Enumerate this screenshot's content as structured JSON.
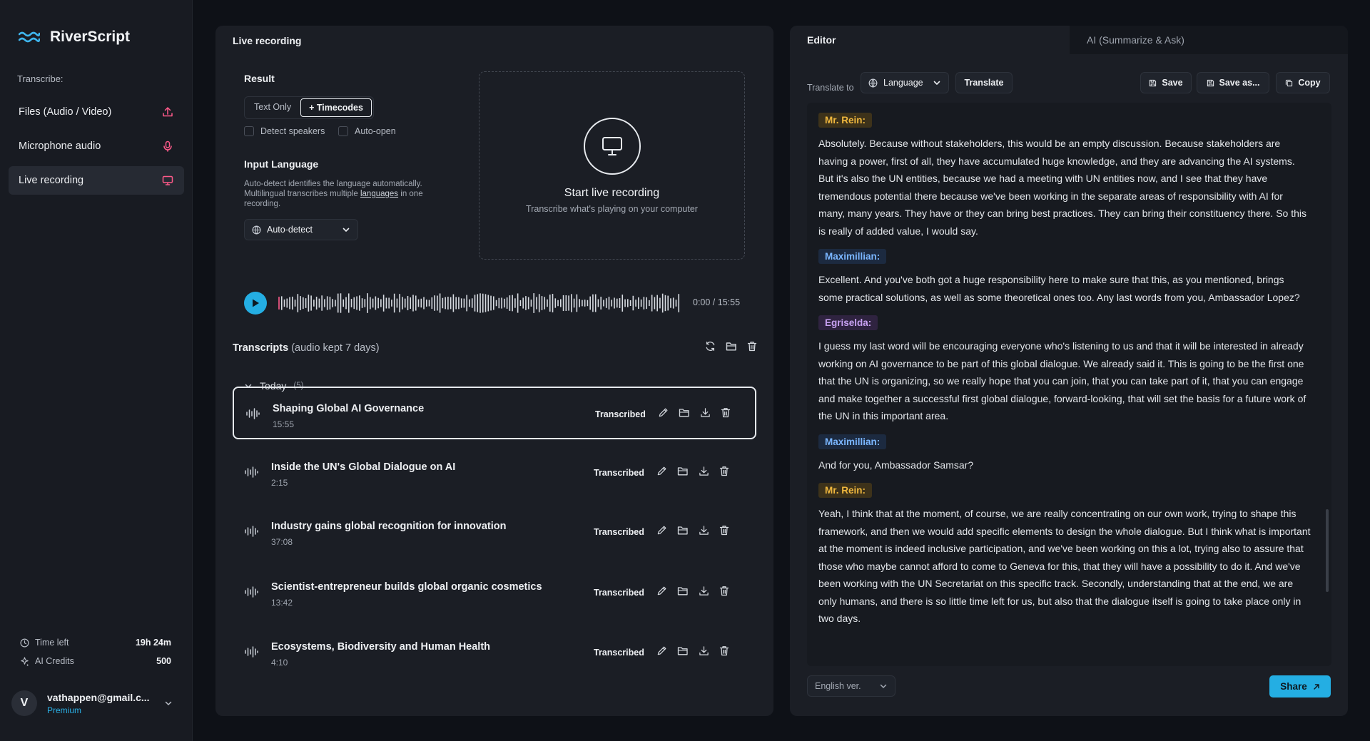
{
  "app": {
    "name": "RiverScript"
  },
  "sidebar": {
    "section_label": "Transcribe:",
    "items": [
      {
        "label": "Files (Audio / Video)",
        "icon": "upload-icon",
        "icon_color": "#ff5a8a"
      },
      {
        "label": "Microphone audio",
        "icon": "microphone-icon",
        "icon_color": "#ff5a8a"
      },
      {
        "label": "Live recording",
        "icon": "monitor-icon",
        "icon_color": "#ff5a8a",
        "active": true
      }
    ],
    "time_left": {
      "label": "Time left",
      "value": "19h 24m"
    },
    "ai_credits": {
      "label": "AI Credits",
      "value": "500"
    },
    "user": {
      "initial": "V",
      "email": "vathappen@gmail.c...",
      "plan": "Premium"
    }
  },
  "live_panel": {
    "title": "Live recording",
    "result_label": "Result",
    "result_options": [
      "Text Only",
      "+ Timecodes"
    ],
    "result_selected": "+ Timecodes",
    "detect_speakers": "Detect speakers",
    "auto_open": "Auto-open",
    "input_language_label": "Input Language",
    "input_language_desc_1": "Auto-detect identifies the language automatically. Multilingual transcribes multiple ",
    "input_language_link": "languages",
    "input_language_desc_2": " in one recording.",
    "language_select": "Auto-detect",
    "drop_title": "Start live recording",
    "drop_sub": "Transcribe what's playing on your computer",
    "player_time": "0:00 / 15:55",
    "progress": 0
  },
  "transcripts": {
    "title": "Transcripts",
    "note": "(audio kept 7 days)",
    "group": "Today",
    "group_count": "(5)",
    "items": [
      {
        "title": "Shaping Global AI Governance",
        "duration": "15:55",
        "status": "Transcribed",
        "selected": true
      },
      {
        "title": "Inside the UN's Global Dialogue on AI",
        "duration": "2:15",
        "status": "Transcribed"
      },
      {
        "title": "Industry gains global recognition for innovation",
        "duration": "37:08",
        "status": "Transcribed"
      },
      {
        "title": "Scientist-entrepreneur builds global organic cosmetics",
        "duration": "13:42",
        "status": "Transcribed"
      },
      {
        "title": "Ecosystems, Biodiversity and Human Health",
        "duration": "4:10",
        "status": "Transcribed"
      }
    ]
  },
  "editor": {
    "tabs": [
      "Editor",
      "AI (Summarize & Ask)"
    ],
    "translate_label": "Translate to",
    "language_select": "Language",
    "translate_button": "Translate",
    "save_button": "Save",
    "save_as_button": "Save as...",
    "copy_button": "Copy",
    "version_select": "English ver.",
    "share_button": "Share",
    "blocks": [
      {
        "speaker": "Mr. Rein:",
        "kind": "rein",
        "text": "Absolutely. Because without stakeholders, this would be an empty discussion. Because stakeholders are having a power, first of all, they have accumulated huge knowledge, and they are advancing the AI systems. But it's also the UN entities, because we had a meeting with UN entities now, and I see that they have tremendous potential there because we've been working in the separate areas of responsibility with AI for many, many years. They have or they can bring best practices. They can bring their constituency there. So this is really of added value, I would say."
      },
      {
        "speaker": "Maximillian:",
        "kind": "max",
        "text": "Excellent. And you've both got a huge responsibility here to make sure that this, as you mentioned, brings some practical solutions, as well as some theoretical ones too. Any last words from you, Ambassador Lopez?"
      },
      {
        "speaker": "Egriselda:",
        "kind": "egr",
        "text": "I guess my last word will be encouraging everyone who's listening to us and that it will be interested in already working on AI governance to be part of this global dialogue. We already said it. This is going to be the first one that the UN is organizing, so we really hope that you can join, that you can take part of it, that you can engage and make together a successful first global dialogue, forward-looking, that will set the basis for a future work of the UN in this important area."
      },
      {
        "speaker": "Maximillian:",
        "kind": "max",
        "text": "And for you, Ambassador Samsar?"
      },
      {
        "speaker": "Mr. Rein:",
        "kind": "rein",
        "text": "Yeah, I think that at the moment, of course, we are really concentrating on our own work, trying to shape this framework, and then we would add specific elements to design the whole dialogue. But I think what is important at the moment is indeed inclusive participation, and we've been working on this a lot, trying also to assure that those who maybe cannot afford to come to Geneva for this, that they will have a possibility to do it. And we've been working with the UN Secretariat on this specific track. Secondly, understanding that at the end, we are only humans, and there is so little time left for us, but also that the dialogue itself is going to take place only in two days."
      }
    ]
  },
  "colors": {
    "accent": "#24aee3",
    "icon_pink": "#ff5a8a"
  }
}
